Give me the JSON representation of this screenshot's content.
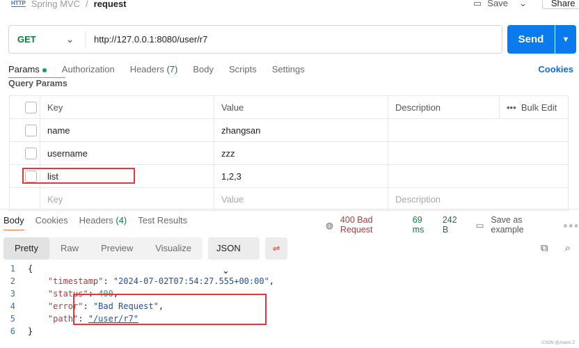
{
  "header": {
    "icon": "HTTP",
    "collection": "Spring MVC",
    "separator": "/",
    "request": "request",
    "save": "Save",
    "share": "Share"
  },
  "request": {
    "method": "GET",
    "url": "http://127.0.0.1:8080/user/r7",
    "send": "Send"
  },
  "tabs": [
    {
      "label": "Params"
    },
    {
      "label": "Authorization"
    },
    {
      "label": "Headers",
      "count": "(7)"
    },
    {
      "label": "Body"
    },
    {
      "label": "Scripts"
    },
    {
      "label": "Settings"
    }
  ],
  "cookies": "Cookies",
  "query_params": "Query Params",
  "table": {
    "headers": [
      "Key",
      "Value",
      "Description"
    ],
    "bulk_edit": "Bulk Edit",
    "rows": [
      {
        "key": "name",
        "value": "zhangsan"
      },
      {
        "key": "username",
        "value": "zzz"
      },
      {
        "key": "list",
        "value": "1,2,3"
      }
    ],
    "placeholder": {
      "key": "Key",
      "value": "Value",
      "description": "Description"
    }
  },
  "response": {
    "tabs": [
      {
        "label": "Body"
      },
      {
        "label": "Cookies"
      },
      {
        "label": "Headers",
        "count": "(4)"
      },
      {
        "label": "Test Results"
      }
    ],
    "status": "400 Bad Request",
    "time": "69 ms",
    "size": "242 B",
    "save_example": "Save as example",
    "formats": [
      "Pretty",
      "Raw",
      "Preview",
      "Visualize"
    ],
    "lang": "JSON",
    "lines": [
      {
        "n": "1",
        "parts": [
          [
            "p",
            "{"
          ]
        ]
      },
      {
        "n": "2",
        "parts": [
          [
            "k",
            "    \"timestamp\""
          ],
          [
            "p",
            ": "
          ],
          [
            "s",
            "\"2024-07-02T07:54:27.555+00:00\""
          ],
          [
            "p",
            ","
          ]
        ]
      },
      {
        "n": "3",
        "parts": [
          [
            "k",
            "    \"status\""
          ],
          [
            "p",
            ": "
          ],
          [
            "n",
            "400"
          ],
          [
            "p",
            ","
          ]
        ]
      },
      {
        "n": "4",
        "parts": [
          [
            "k",
            "    \"error\""
          ],
          [
            "p",
            ": "
          ],
          [
            "s",
            "\"Bad Request\""
          ],
          [
            "p",
            ","
          ]
        ]
      },
      {
        "n": "5",
        "parts": [
          [
            "k",
            "    \"path\""
          ],
          [
            "p",
            ": "
          ],
          [
            "s",
            "\"/user/r7\""
          ]
        ]
      },
      {
        "n": "6",
        "parts": [
          [
            "p",
            "}"
          ]
        ]
      }
    ]
  },
  "watermark": "CSDN @Anemi Z"
}
